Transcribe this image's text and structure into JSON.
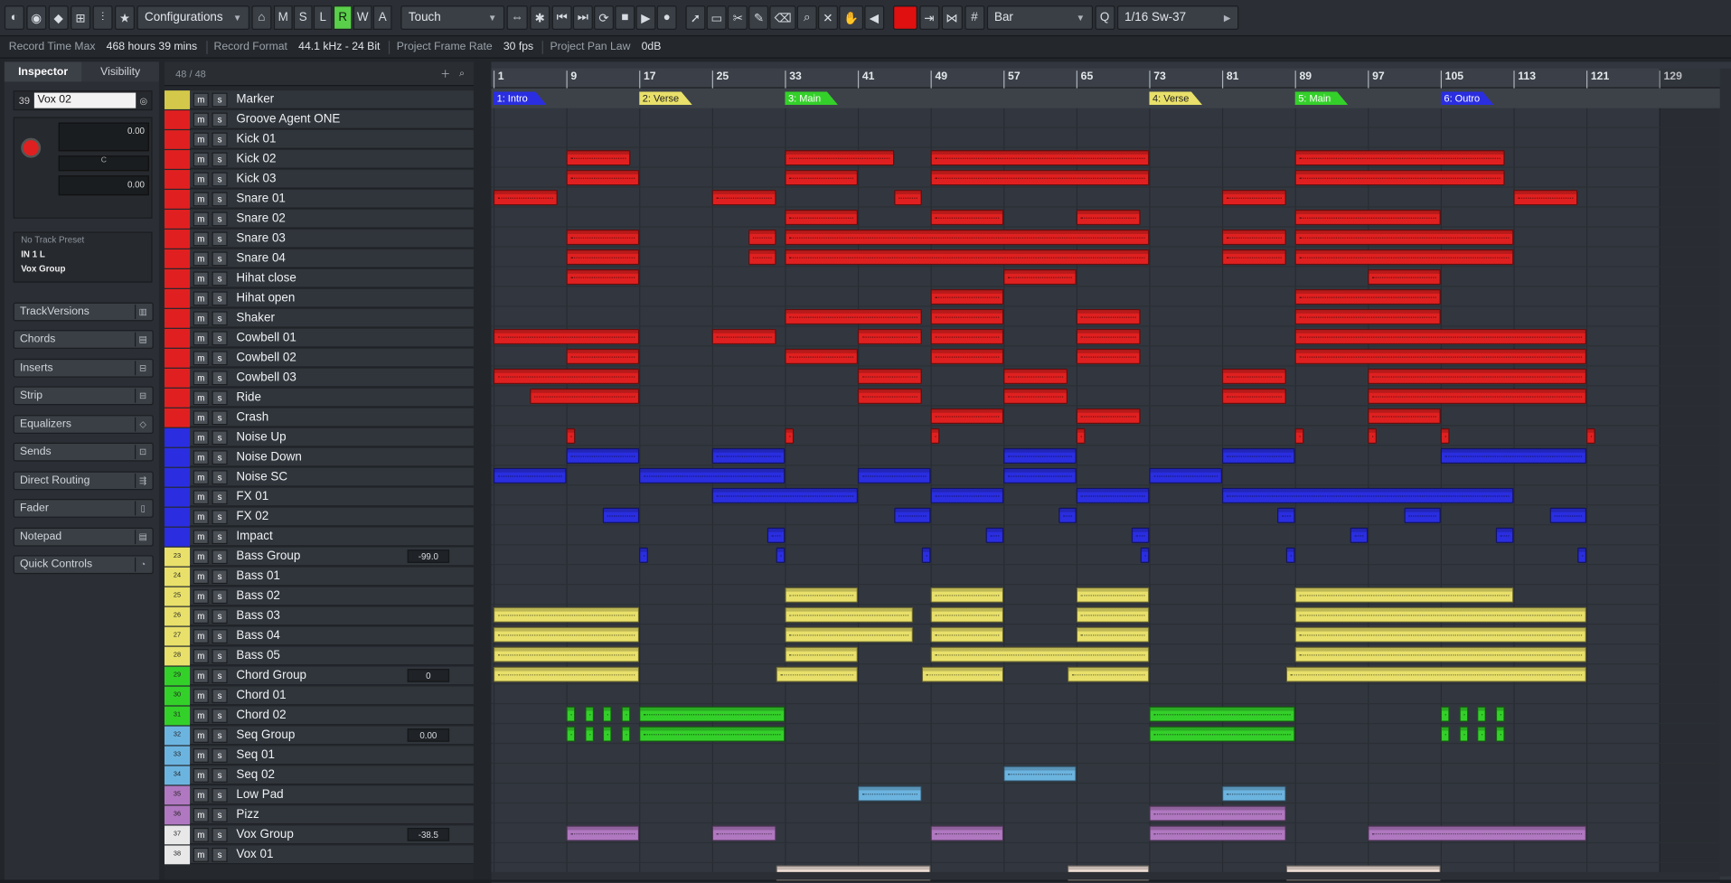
{
  "toolbar": {
    "configurations_label": "Configurations",
    "mslrwa": [
      "M",
      "S",
      "L",
      "R",
      "W",
      "A"
    ],
    "mslrwa_active": "R",
    "automation_mode": "Touch",
    "snap_type": "Bar",
    "quantize": "1/16 Sw-37",
    "color_swatch": "#e01010"
  },
  "infobar": {
    "items": [
      {
        "key": "Record Time Max",
        "value": "468 hours 39 mins"
      },
      {
        "key": "Record Format",
        "value": "44.1 kHz - 24 Bit"
      },
      {
        "key": "Project Frame Rate",
        "value": "30 fps"
      },
      {
        "key": "Project Pan Law",
        "value": "0dB"
      }
    ]
  },
  "inspector": {
    "tabs": [
      "Inspector",
      "Visibility"
    ],
    "track_number": "39",
    "track_name": "Vox 02",
    "volume": "0.00",
    "pan": "C",
    "pan_value": "0.00",
    "preset": "No Track Preset",
    "input": "IN 1 L",
    "output": "Vox Group",
    "sections": [
      "TrackVersions",
      "Chords",
      "Inserts",
      "Strip",
      "Equalizers",
      "Sends",
      "Direct Routing",
      "Fader",
      "Notepad",
      "Quick Controls"
    ]
  },
  "tracklist": {
    "count": "48 / 48",
    "tracks": [
      {
        "name": "Marker",
        "color": "#d4c84a",
        "num": ""
      },
      {
        "name": "Groove Agent ONE",
        "color": "#e02020",
        "num": ""
      },
      {
        "name": "Kick 01",
        "color": "#e02020",
        "num": ""
      },
      {
        "name": "Kick 02",
        "color": "#e02020",
        "num": ""
      },
      {
        "name": "Kick 03",
        "color": "#e02020",
        "num": ""
      },
      {
        "name": "Snare 01",
        "color": "#e02020",
        "num": ""
      },
      {
        "name": "Snare 02",
        "color": "#e02020",
        "num": ""
      },
      {
        "name": "Snare 03",
        "color": "#e02020",
        "num": ""
      },
      {
        "name": "Snare 04",
        "color": "#e02020",
        "num": ""
      },
      {
        "name": "Hihat close",
        "color": "#e02020",
        "num": ""
      },
      {
        "name": "Hihat open",
        "color": "#e02020",
        "num": ""
      },
      {
        "name": "Shaker",
        "color": "#e02020",
        "num": ""
      },
      {
        "name": "Cowbell 01",
        "color": "#e02020",
        "num": ""
      },
      {
        "name": "Cowbell 02",
        "color": "#e02020",
        "num": ""
      },
      {
        "name": "Cowbell 03",
        "color": "#e02020",
        "num": ""
      },
      {
        "name": "Ride",
        "color": "#e02020",
        "num": ""
      },
      {
        "name": "Crash",
        "color": "#e02020",
        "num": ""
      },
      {
        "name": "Noise Up",
        "color": "#2a2ee0",
        "num": ""
      },
      {
        "name": "Noise Down",
        "color": "#2a2ee0",
        "num": ""
      },
      {
        "name": "Noise SC",
        "color": "#2a2ee0",
        "num": ""
      },
      {
        "name": "FX 01",
        "color": "#2a2ee0",
        "num": ""
      },
      {
        "name": "FX 02",
        "color": "#2a2ee0",
        "num": ""
      },
      {
        "name": "Impact",
        "color": "#2a2ee0",
        "num": ""
      },
      {
        "name": "Bass Group",
        "color": "#e8e06a",
        "num": "23",
        "value": "-99.0"
      },
      {
        "name": "Bass 01",
        "color": "#e8e06a",
        "num": "24"
      },
      {
        "name": "Bass 02",
        "color": "#e8e06a",
        "num": "25"
      },
      {
        "name": "Bass 03",
        "color": "#e8e06a",
        "num": "26"
      },
      {
        "name": "Bass 04",
        "color": "#e8e06a",
        "num": "27"
      },
      {
        "name": "Bass 05",
        "color": "#e8e06a",
        "num": "28"
      },
      {
        "name": "Chord Group",
        "color": "#34d02a",
        "num": "29",
        "value": "0"
      },
      {
        "name": "Chord 01",
        "color": "#34d02a",
        "num": "30"
      },
      {
        "name": "Chord 02",
        "color": "#34d02a",
        "num": "31"
      },
      {
        "name": "Seq Group",
        "color": "#6cb4e0",
        "num": "32",
        "value": "0.00"
      },
      {
        "name": "Seq 01",
        "color": "#6cb4e0",
        "num": "33"
      },
      {
        "name": "Seq 02",
        "color": "#6cb4e0",
        "num": "34"
      },
      {
        "name": "Low Pad",
        "color": "#b078c0",
        "num": "35"
      },
      {
        "name": "Pizz",
        "color": "#b078c0",
        "num": "36"
      },
      {
        "name": "Vox Group",
        "color": "#e8e8e8",
        "num": "37",
        "value": "-38.5"
      },
      {
        "name": "Vox 01",
        "color": "#e8e8e8",
        "num": "38"
      }
    ]
  },
  "ruler": {
    "bars": [
      "1",
      "9",
      "17",
      "25",
      "33",
      "41",
      "49",
      "57",
      "65",
      "73",
      "81",
      "89",
      "97",
      "105",
      "113",
      "121",
      "129"
    ]
  },
  "markers": [
    {
      "label": "1: Intro",
      "color": "#2a2ee0",
      "bar": 1
    },
    {
      "label": "2: Verse",
      "color": "#e8e06a",
      "bar": 17
    },
    {
      "label": "3: Main",
      "color": "#34d02a",
      "bar": 33
    },
    {
      "label": "4: Verse",
      "color": "#e8e06a",
      "bar": 73
    },
    {
      "label": "5: Main",
      "color": "#34d02a",
      "bar": 89
    },
    {
      "label": "6: Outro",
      "color": "#2a2ee0",
      "bar": 105
    }
  ],
  "clips": [
    {
      "lane": 2,
      "color": "#e02020",
      "s": 9,
      "e": 16
    },
    {
      "lane": 2,
      "color": "#e02020",
      "s": 33,
      "e": 45
    },
    {
      "lane": 2,
      "color": "#e02020",
      "s": 49,
      "e": 73
    },
    {
      "lane": 2,
      "color": "#e02020",
      "s": 89,
      "e": 112
    },
    {
      "lane": 3,
      "color": "#e02020",
      "s": 9,
      "e": 17
    },
    {
      "lane": 3,
      "color": "#e02020",
      "s": 33,
      "e": 41
    },
    {
      "lane": 3,
      "color": "#e02020",
      "s": 49,
      "e": 73
    },
    {
      "lane": 3,
      "color": "#e02020",
      "s": 89,
      "e": 112
    },
    {
      "lane": 4,
      "color": "#e02020",
      "s": 1,
      "e": 8
    },
    {
      "lane": 4,
      "color": "#e02020",
      "s": 25,
      "e": 32
    },
    {
      "lane": 4,
      "color": "#e02020",
      "s": 45,
      "e": 48
    },
    {
      "lane": 4,
      "color": "#e02020",
      "s": 81,
      "e": 88
    },
    {
      "lane": 4,
      "color": "#e02020",
      "s": 113,
      "e": 120
    },
    {
      "lane": 5,
      "color": "#e02020",
      "s": 33,
      "e": 41
    },
    {
      "lane": 5,
      "color": "#e02020",
      "s": 49,
      "e": 57
    },
    {
      "lane": 5,
      "color": "#e02020",
      "s": 65,
      "e": 72
    },
    {
      "lane": 5,
      "color": "#e02020",
      "s": 89,
      "e": 105
    },
    {
      "lane": 6,
      "color": "#e02020",
      "s": 9,
      "e": 17
    },
    {
      "lane": 6,
      "color": "#e02020",
      "s": 29,
      "e": 32
    },
    {
      "lane": 6,
      "color": "#e02020",
      "s": 33,
      "e": 73
    },
    {
      "lane": 6,
      "color": "#e02020",
      "s": 81,
      "e": 88
    },
    {
      "lane": 6,
      "color": "#e02020",
      "s": 89,
      "e": 113
    },
    {
      "lane": 7,
      "color": "#e02020",
      "s": 9,
      "e": 17
    },
    {
      "lane": 7,
      "color": "#e02020",
      "s": 29,
      "e": 32
    },
    {
      "lane": 7,
      "color": "#e02020",
      "s": 33,
      "e": 73
    },
    {
      "lane": 7,
      "color": "#e02020",
      "s": 81,
      "e": 88
    },
    {
      "lane": 7,
      "color": "#e02020",
      "s": 89,
      "e": 113
    },
    {
      "lane": 8,
      "color": "#e02020",
      "s": 9,
      "e": 17
    },
    {
      "lane": 8,
      "color": "#e02020",
      "s": 57,
      "e": 65
    },
    {
      "lane": 8,
      "color": "#e02020",
      "s": 97,
      "e": 105
    },
    {
      "lane": 9,
      "color": "#e02020",
      "s": 49,
      "e": 57
    },
    {
      "lane": 9,
      "color": "#e02020",
      "s": 89,
      "e": 105
    },
    {
      "lane": 10,
      "color": "#e02020",
      "s": 33,
      "e": 48
    },
    {
      "lane": 10,
      "color": "#e02020",
      "s": 49,
      "e": 57
    },
    {
      "lane": 10,
      "color": "#e02020",
      "s": 65,
      "e": 72
    },
    {
      "lane": 10,
      "color": "#e02020",
      "s": 89,
      "e": 105
    },
    {
      "lane": 11,
      "color": "#e02020",
      "s": 1,
      "e": 17
    },
    {
      "lane": 11,
      "color": "#e02020",
      "s": 25,
      "e": 32
    },
    {
      "lane": 11,
      "color": "#e02020",
      "s": 41,
      "e": 48
    },
    {
      "lane": 11,
      "color": "#e02020",
      "s": 49,
      "e": 57
    },
    {
      "lane": 11,
      "color": "#e02020",
      "s": 65,
      "e": 72
    },
    {
      "lane": 11,
      "color": "#e02020",
      "s": 89,
      "e": 121
    },
    {
      "lane": 12,
      "color": "#e02020",
      "s": 9,
      "e": 17
    },
    {
      "lane": 12,
      "color": "#e02020",
      "s": 33,
      "e": 41
    },
    {
      "lane": 12,
      "color": "#e02020",
      "s": 49,
      "e": 57
    },
    {
      "lane": 12,
      "color": "#e02020",
      "s": 65,
      "e": 72
    },
    {
      "lane": 12,
      "color": "#e02020",
      "s": 89,
      "e": 121
    },
    {
      "lane": 13,
      "color": "#e02020",
      "s": 1,
      "e": 17
    },
    {
      "lane": 13,
      "color": "#e02020",
      "s": 41,
      "e": 48
    },
    {
      "lane": 13,
      "color": "#e02020",
      "s": 57,
      "e": 64
    },
    {
      "lane": 13,
      "color": "#e02020",
      "s": 81,
      "e": 88
    },
    {
      "lane": 13,
      "color": "#e02020",
      "s": 97,
      "e": 121
    },
    {
      "lane": 14,
      "color": "#e02020",
      "s": 5,
      "e": 17
    },
    {
      "lane": 14,
      "color": "#e02020",
      "s": 41,
      "e": 48
    },
    {
      "lane": 14,
      "color": "#e02020",
      "s": 57,
      "e": 64
    },
    {
      "lane": 14,
      "color": "#e02020",
      "s": 81,
      "e": 88
    },
    {
      "lane": 14,
      "color": "#e02020",
      "s": 97,
      "e": 121
    },
    {
      "lane": 15,
      "color": "#e02020",
      "s": 49,
      "e": 57
    },
    {
      "lane": 15,
      "color": "#e02020",
      "s": 65,
      "e": 72
    },
    {
      "lane": 15,
      "color": "#e02020",
      "s": 97,
      "e": 105
    },
    {
      "lane": 16,
      "color": "#e02020",
      "s": 9,
      "e": 10
    },
    {
      "lane": 16,
      "color": "#e02020",
      "s": 33,
      "e": 34
    },
    {
      "lane": 16,
      "color": "#e02020",
      "s": 49,
      "e": 50
    },
    {
      "lane": 16,
      "color": "#e02020",
      "s": 65,
      "e": 66
    },
    {
      "lane": 16,
      "color": "#e02020",
      "s": 89,
      "e": 90
    },
    {
      "lane": 16,
      "color": "#e02020",
      "s": 97,
      "e": 98
    },
    {
      "lane": 16,
      "color": "#e02020",
      "s": 105,
      "e": 106
    },
    {
      "lane": 16,
      "color": "#e02020",
      "s": 121,
      "e": 122
    },
    {
      "lane": 17,
      "color": "#2a2ee0",
      "s": 9,
      "e": 17
    },
    {
      "lane": 17,
      "color": "#2a2ee0",
      "s": 25,
      "e": 33
    },
    {
      "lane": 17,
      "color": "#2a2ee0",
      "s": 57,
      "e": 65
    },
    {
      "lane": 17,
      "color": "#2a2ee0",
      "s": 81,
      "e": 89
    },
    {
      "lane": 17,
      "color": "#2a2ee0",
      "s": 105,
      "e": 121
    },
    {
      "lane": 18,
      "color": "#2a2ee0",
      "s": 1,
      "e": 9
    },
    {
      "lane": 18,
      "color": "#2a2ee0",
      "s": 17,
      "e": 33
    },
    {
      "lane": 18,
      "color": "#2a2ee0",
      "s": 41,
      "e": 49
    },
    {
      "lane": 18,
      "color": "#2a2ee0",
      "s": 57,
      "e": 65
    },
    {
      "lane": 18,
      "color": "#2a2ee0",
      "s": 73,
      "e": 81
    },
    {
      "lane": 19,
      "color": "#2a2ee0",
      "s": 25,
      "e": 41
    },
    {
      "lane": 19,
      "color": "#2a2ee0",
      "s": 49,
      "e": 57
    },
    {
      "lane": 19,
      "color": "#2a2ee0",
      "s": 65,
      "e": 73
    },
    {
      "lane": 19,
      "color": "#2a2ee0",
      "s": 81,
      "e": 113
    },
    {
      "lane": 20,
      "color": "#2a2ee0",
      "s": 13,
      "e": 17
    },
    {
      "lane": 20,
      "color": "#2a2ee0",
      "s": 45,
      "e": 49
    },
    {
      "lane": 20,
      "color": "#2a2ee0",
      "s": 63,
      "e": 65
    },
    {
      "lane": 20,
      "color": "#2a2ee0",
      "s": 87,
      "e": 89
    },
    {
      "lane": 20,
      "color": "#2a2ee0",
      "s": 101,
      "e": 105
    },
    {
      "lane": 20,
      "color": "#2a2ee0",
      "s": 117,
      "e": 121
    },
    {
      "lane": 21,
      "color": "#2a2ee0",
      "s": 31,
      "e": 33
    },
    {
      "lane": 21,
      "color": "#2a2ee0",
      "s": 55,
      "e": 57
    },
    {
      "lane": 21,
      "color": "#2a2ee0",
      "s": 71,
      "e": 73
    },
    {
      "lane": 21,
      "color": "#2a2ee0",
      "s": 95,
      "e": 97
    },
    {
      "lane": 21,
      "color": "#2a2ee0",
      "s": 111,
      "e": 113
    },
    {
      "lane": 22,
      "color": "#2a2ee0",
      "s": 17,
      "e": 18
    },
    {
      "lane": 22,
      "color": "#2a2ee0",
      "s": 32,
      "e": 33
    },
    {
      "lane": 22,
      "color": "#2a2ee0",
      "s": 48,
      "e": 49
    },
    {
      "lane": 22,
      "color": "#2a2ee0",
      "s": 72,
      "e": 73
    },
    {
      "lane": 22,
      "color": "#2a2ee0",
      "s": 88,
      "e": 89
    },
    {
      "lane": 22,
      "color": "#2a2ee0",
      "s": 120,
      "e": 121
    },
    {
      "lane": 24,
      "color": "#e8e06a",
      "s": 33,
      "e": 41
    },
    {
      "lane": 24,
      "color": "#e8e06a",
      "s": 49,
      "e": 57
    },
    {
      "lane": 24,
      "color": "#e8e06a",
      "s": 65,
      "e": 73
    },
    {
      "lane": 24,
      "color": "#e8e06a",
      "s": 89,
      "e": 113
    },
    {
      "lane": 25,
      "color": "#e8e06a",
      "s": 1,
      "e": 17
    },
    {
      "lane": 25,
      "color": "#e8e06a",
      "s": 33,
      "e": 47
    },
    {
      "lane": 25,
      "color": "#e8e06a",
      "s": 49,
      "e": 57
    },
    {
      "lane": 25,
      "color": "#e8e06a",
      "s": 65,
      "e": 73
    },
    {
      "lane": 25,
      "color": "#e8e06a",
      "s": 89,
      "e": 121
    },
    {
      "lane": 26,
      "color": "#e8e06a",
      "s": 1,
      "e": 17
    },
    {
      "lane": 26,
      "color": "#e8e06a",
      "s": 33,
      "e": 47
    },
    {
      "lane": 26,
      "color": "#e8e06a",
      "s": 49,
      "e": 57
    },
    {
      "lane": 26,
      "color": "#e8e06a",
      "s": 65,
      "e": 73
    },
    {
      "lane": 26,
      "color": "#e8e06a",
      "s": 89,
      "e": 121
    },
    {
      "lane": 27,
      "color": "#e8e06a",
      "s": 1,
      "e": 17
    },
    {
      "lane": 27,
      "color": "#e8e06a",
      "s": 33,
      "e": 41
    },
    {
      "lane": 27,
      "color": "#e8e06a",
      "s": 49,
      "e": 73
    },
    {
      "lane": 27,
      "color": "#e8e06a",
      "s": 89,
      "e": 121
    },
    {
      "lane": 28,
      "color": "#e8e06a",
      "s": 1,
      "e": 17
    },
    {
      "lane": 28,
      "color": "#e8e06a",
      "s": 32,
      "e": 41
    },
    {
      "lane": 28,
      "color": "#e8e06a",
      "s": 48,
      "e": 57
    },
    {
      "lane": 28,
      "color": "#e8e06a",
      "s": 64,
      "e": 73
    },
    {
      "lane": 28,
      "color": "#e8e06a",
      "s": 88,
      "e": 121
    },
    {
      "lane": 30,
      "color": "#34d02a",
      "s": 9,
      "e": 10
    },
    {
      "lane": 30,
      "color": "#34d02a",
      "s": 11,
      "e": 12
    },
    {
      "lane": 30,
      "color": "#34d02a",
      "s": 13,
      "e": 14
    },
    {
      "lane": 30,
      "color": "#34d02a",
      "s": 15,
      "e": 16
    },
    {
      "lane": 30,
      "color": "#34d02a",
      "s": 17,
      "e": 33
    },
    {
      "lane": 30,
      "color": "#34d02a",
      "s": 73,
      "e": 89
    },
    {
      "lane": 30,
      "color": "#34d02a",
      "s": 105,
      "e": 106
    },
    {
      "lane": 30,
      "color": "#34d02a",
      "s": 107,
      "e": 108
    },
    {
      "lane": 30,
      "color": "#34d02a",
      "s": 109,
      "e": 110
    },
    {
      "lane": 30,
      "color": "#34d02a",
      "s": 111,
      "e": 112
    },
    {
      "lane": 31,
      "color": "#34d02a",
      "s": 9,
      "e": 10
    },
    {
      "lane": 31,
      "color": "#34d02a",
      "s": 11,
      "e": 12
    },
    {
      "lane": 31,
      "color": "#34d02a",
      "s": 13,
      "e": 14
    },
    {
      "lane": 31,
      "color": "#34d02a",
      "s": 15,
      "e": 16
    },
    {
      "lane": 31,
      "color": "#34d02a",
      "s": 17,
      "e": 33
    },
    {
      "lane": 31,
      "color": "#34d02a",
      "s": 73,
      "e": 89
    },
    {
      "lane": 31,
      "color": "#34d02a",
      "s": 105,
      "e": 106
    },
    {
      "lane": 31,
      "color": "#34d02a",
      "s": 107,
      "e": 108
    },
    {
      "lane": 31,
      "color": "#34d02a",
      "s": 109,
      "e": 110
    },
    {
      "lane": 31,
      "color": "#34d02a",
      "s": 111,
      "e": 112
    },
    {
      "lane": 33,
      "color": "#6cb4e0",
      "s": 57,
      "e": 65
    },
    {
      "lane": 34,
      "color": "#6cb4e0",
      "s": 41,
      "e": 48
    },
    {
      "lane": 34,
      "color": "#6cb4e0",
      "s": 81,
      "e": 88
    },
    {
      "lane": 35,
      "color": "#b078c0",
      "s": 73,
      "e": 88
    },
    {
      "lane": 36,
      "color": "#b078c0",
      "s": 9,
      "e": 17
    },
    {
      "lane": 36,
      "color": "#b078c0",
      "s": 25,
      "e": 32
    },
    {
      "lane": 36,
      "color": "#b078c0",
      "s": 49,
      "e": 57
    },
    {
      "lane": 36,
      "color": "#b078c0",
      "s": 73,
      "e": 88
    },
    {
      "lane": 36,
      "color": "#b078c0",
      "s": 97,
      "e": 121
    },
    {
      "lane": 38,
      "color": "#f0e0d8",
      "s": 32,
      "e": 49
    },
    {
      "lane": 38,
      "color": "#f0e0d8",
      "s": 64,
      "e": 73
    },
    {
      "lane": 38,
      "color": "#f0e0d8",
      "s": 88,
      "e": 105
    }
  ]
}
